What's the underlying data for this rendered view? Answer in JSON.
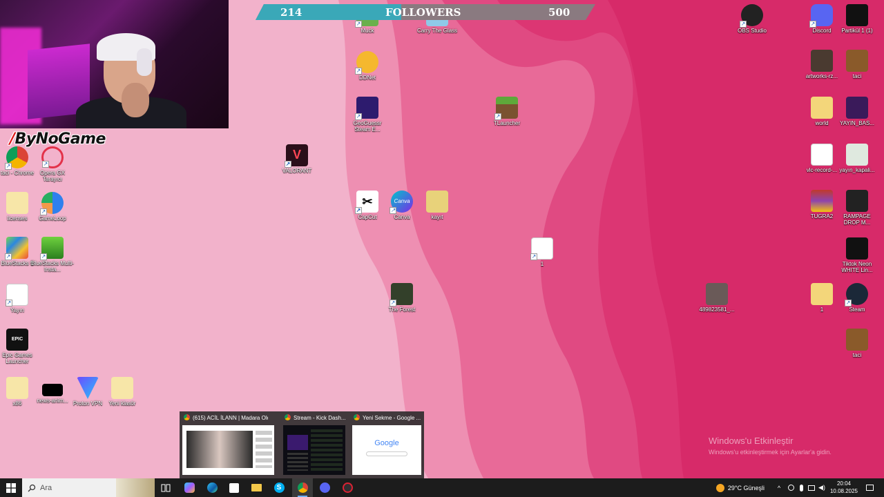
{
  "followers": {
    "current": "214",
    "label": "FOLLOWERS",
    "goal": "500",
    "progress_fraction": 0.428
  },
  "channel_logo": "ByNoGame",
  "desktop_icons": {
    "col1": [
      "taci - Chrome",
      "licenses",
      "BlueStacks 5",
      "Yayın",
      "Epic Games Launcher",
      "x86"
    ],
    "col2": [
      "Opera GX Tarayıcı",
      "GameLoop",
      "BlueStacks Multi-Insta...",
      "news-anim...",
      "Proton VPN"
    ],
    "col3": [
      "VALORANT"
    ],
    "col4": [
      "Yeni klasör"
    ],
    "mid": [
      "Muck",
      "Carry The Glass",
      "DDNet",
      "GeoGuessr Steam E...",
      "TLauncher",
      "CapCut",
      "Canva",
      "kayıt",
      "The Forest",
      "1"
    ],
    "right": [
      "OBS Studio",
      "Discord",
      "Partikül 1 (1)",
      "artworks-rz...",
      "taci",
      "world",
      "YAYIN_BAS...",
      "vlc-record-...",
      "yayın_kapali...",
      "TUGRA2",
      "RAMPAGE DROP M...",
      "Tiktok Neon WHITE Lin...",
      "489823581_...",
      "1",
      "Steam",
      "taci"
    ]
  },
  "previews": [
    {
      "title": "(615) ACİL İLANN | Madara Old..."
    },
    {
      "title": "Stream - Kick Dash..."
    },
    {
      "title": "Yeni Sekme - Google ..."
    }
  ],
  "preview_google_text": "Google",
  "watermark": {
    "line1": "Windows'u Etkinleştir",
    "line2": "Windows'u etkinleştirmek için Ayarlar'a gidin."
  },
  "taskbar": {
    "search_placeholder": "Ara",
    "weather": "29°C Güneşli",
    "time": "20:04",
    "date": "10.08.2025"
  }
}
